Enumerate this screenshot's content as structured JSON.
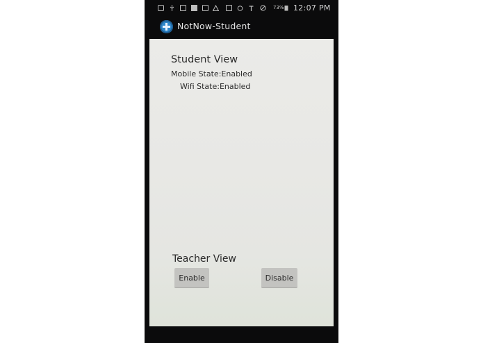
{
  "status_bar": {
    "battery": "73%",
    "time": "12:07 PM",
    "icons": [
      "play-store-icon",
      "usb-icon",
      "sim-icon",
      "facebook-icon",
      "image-icon",
      "warning-icon",
      "nfc-icon",
      "alarm-icon",
      "signal-icon",
      "do-not-disturb-icon"
    ]
  },
  "app": {
    "title": "NotNow-Student",
    "icon": "app-logo-icon"
  },
  "student_view": {
    "heading": "Student View",
    "mobile_label": "Mobile State:",
    "mobile_value": "Enabled",
    "wifi_label": "Wifi State:",
    "wifi_value": "Enabled"
  },
  "teacher_view": {
    "heading": "Teacher View",
    "enable_label": "Enable",
    "disable_label": "Disable"
  },
  "colors": {
    "phone_frame": "#0b0b0c",
    "screen_bg": "#e9e9e6",
    "button_bg": "#c3c3c0",
    "app_icon": "#2e86c9"
  }
}
